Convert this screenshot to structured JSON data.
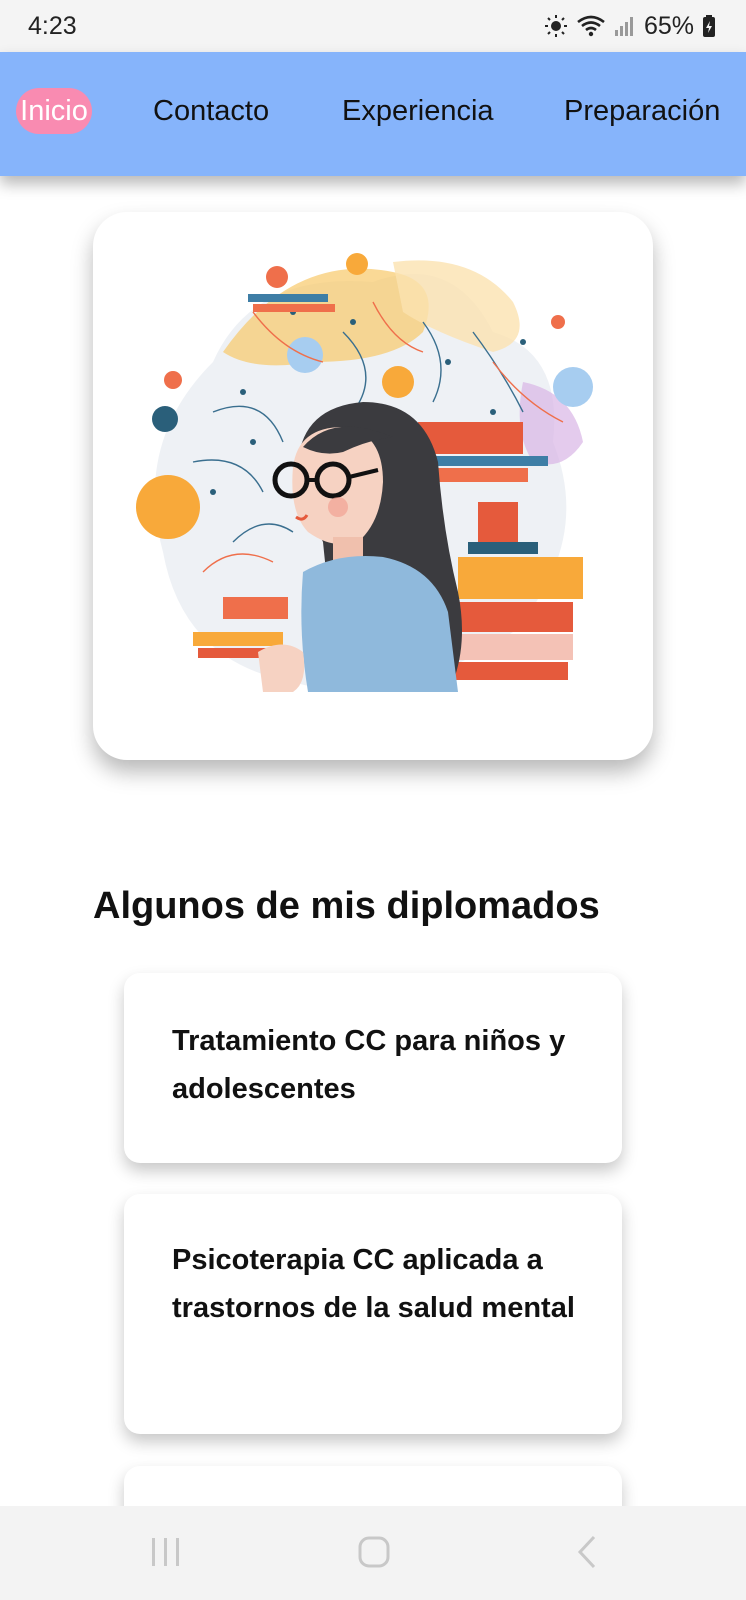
{
  "status": {
    "time": "4:23",
    "battery": "65%",
    "icons": [
      "brightness-icon",
      "wifi-icon",
      "signal-icon",
      "battery-charging-icon"
    ]
  },
  "nav": {
    "items": [
      {
        "label": "Inicio",
        "active": true
      },
      {
        "label": "Contacto",
        "active": false
      },
      {
        "label": "Experiencia",
        "active": false
      },
      {
        "label": "Preparación",
        "active": false
      }
    ],
    "bg_color": "#86b4fb",
    "active_color": "#f98bb1"
  },
  "hero": {
    "image": "illustration-woman-glasses-books"
  },
  "diplomas": {
    "title": "Algunos de mis diplomados",
    "items": [
      {
        "text": "Tratamiento CC para niños y adolescentes"
      },
      {
        "text": "Psicoterapia CC aplicada a trastornos de la salud mental"
      },
      {
        "text": ""
      }
    ]
  },
  "system_nav": {
    "buttons": [
      "recents-icon",
      "home-icon",
      "back-icon"
    ]
  }
}
